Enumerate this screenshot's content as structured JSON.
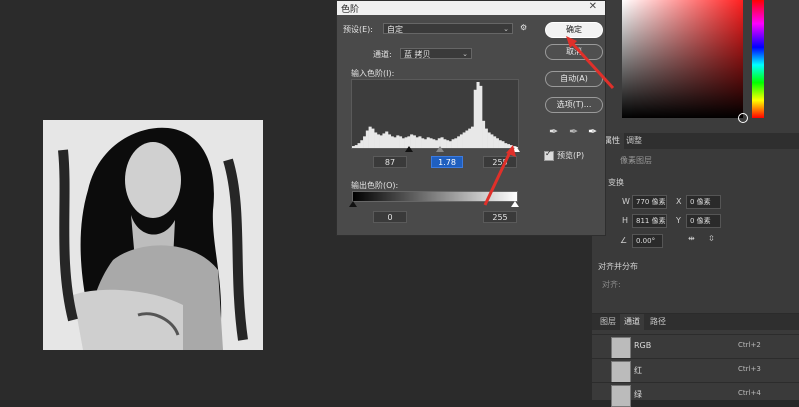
{
  "dialog": {
    "title": "色阶",
    "preset_label": "预设(E):",
    "preset_value": "自定",
    "channel_label": "通道:",
    "channel_value": "蓝 拷贝",
    "input_levels_label": "输入色阶(I):",
    "output_levels_label": "输出色阶(O):",
    "input_black": "87",
    "input_gamma": "1.78",
    "input_white": "255",
    "output_black": "0",
    "output_white": "255",
    "preview_label": "预览(P)",
    "preview_checked": true,
    "buttons": {
      "ok": "确定",
      "cancel": "取消",
      "auto": "自动(A)",
      "options": "选项(T)..."
    },
    "histogram_bars": [
      2,
      3,
      5,
      8,
      12,
      18,
      22,
      20,
      16,
      14,
      13,
      15,
      17,
      14,
      12,
      11,
      13,
      12,
      10,
      11,
      12,
      14,
      13,
      11,
      12,
      10,
      9,
      11,
      10,
      9,
      8,
      10,
      11,
      9,
      8,
      7,
      9,
      10,
      12,
      14,
      16,
      18,
      20,
      22,
      60,
      68,
      64,
      28,
      20,
      16,
      14,
      12,
      10,
      8,
      7,
      5,
      4,
      3,
      2,
      1
    ]
  },
  "properties": {
    "tabs": [
      "属性",
      "调整"
    ],
    "layer_label": "像素图层",
    "transform_label": "变换",
    "w_label": "W",
    "w_value": "770 像素",
    "x_label": "X",
    "x_value": "0 像素",
    "h_label": "H",
    "h_value": "811 像素",
    "y_label": "Y",
    "y_value": "0 像素",
    "angle_value": "0.00°",
    "align_label": "对齐并分布",
    "align_sub": "对齐:"
  },
  "channels": {
    "tabs": [
      "图层",
      "通道",
      "路径"
    ],
    "active_tab": "通道",
    "rows": [
      {
        "name": "RGB",
        "key": "Ctrl+2"
      },
      {
        "name": "红",
        "key": "Ctrl+3"
      },
      {
        "name": "绿",
        "key": "Ctrl+4"
      }
    ]
  },
  "colors": {
    "accent": "#1f5fbf",
    "arrow": "#e0302a"
  }
}
